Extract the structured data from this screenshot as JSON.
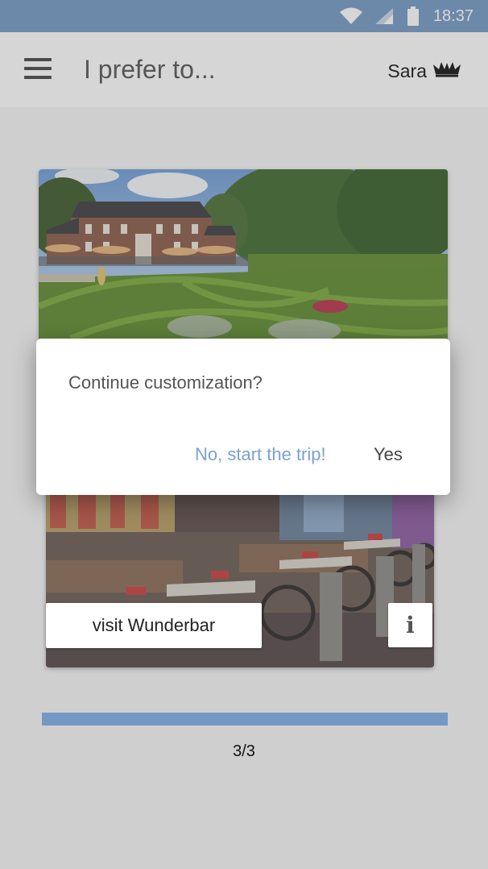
{
  "status_bar": {
    "time": "18:37",
    "icons": [
      "wifi-icon",
      "signal-icon",
      "battery-icon"
    ]
  },
  "app_bar": {
    "menu_icon": "hamburger-menu-icon",
    "title": "I prefer to...",
    "user_name": "Sara",
    "user_icon": "crown-icon"
  },
  "cards": [
    {
      "image": "garden-with-manor-house",
      "description": "photo of formal hedge garden in front of a brick manor house"
    },
    {
      "image": "wunderbar-interior",
      "action_label": "visit Wunderbar",
      "info_label": "i"
    }
  ],
  "dialog": {
    "title": "Continue customization?",
    "negative_label": "No, start the trip!",
    "positive_label": "Yes"
  },
  "progress": {
    "fraction": 1.0,
    "label": "3/3"
  },
  "colors": {
    "primary": "#7398c4",
    "dialog_link": "#7ba2cf",
    "background": "#f6f6f6"
  }
}
